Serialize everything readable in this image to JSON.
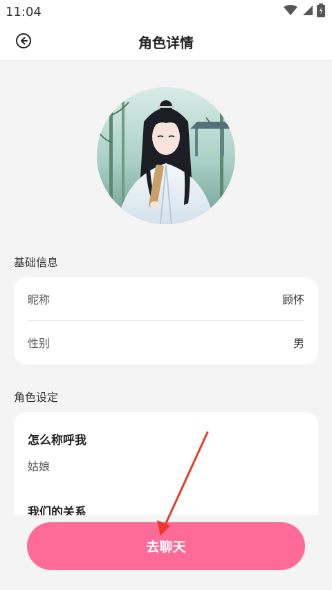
{
  "status_bar": {
    "time": "11:04",
    "icons": [
      "wifi-icon",
      "signal-icon",
      "battery-icon"
    ]
  },
  "header": {
    "title": "角色详情",
    "back_icon": "back-arrow-circle-icon"
  },
  "basic_info": {
    "section_label": "基础信息",
    "rows": [
      {
        "key": "昵称",
        "value": "顾怀"
      },
      {
        "key": "性别",
        "value": "男"
      }
    ]
  },
  "role_settings": {
    "section_label": "角色设定",
    "items": [
      {
        "title": "怎么称呼我",
        "value": "姑娘"
      },
      {
        "title": "我们的关系",
        "value": ""
      }
    ]
  },
  "footer": {
    "chat_button_label": "去聊天"
  },
  "colors": {
    "accent": "#ff6b98",
    "annotation": "#e8392a",
    "background": "#f4f4f4"
  }
}
